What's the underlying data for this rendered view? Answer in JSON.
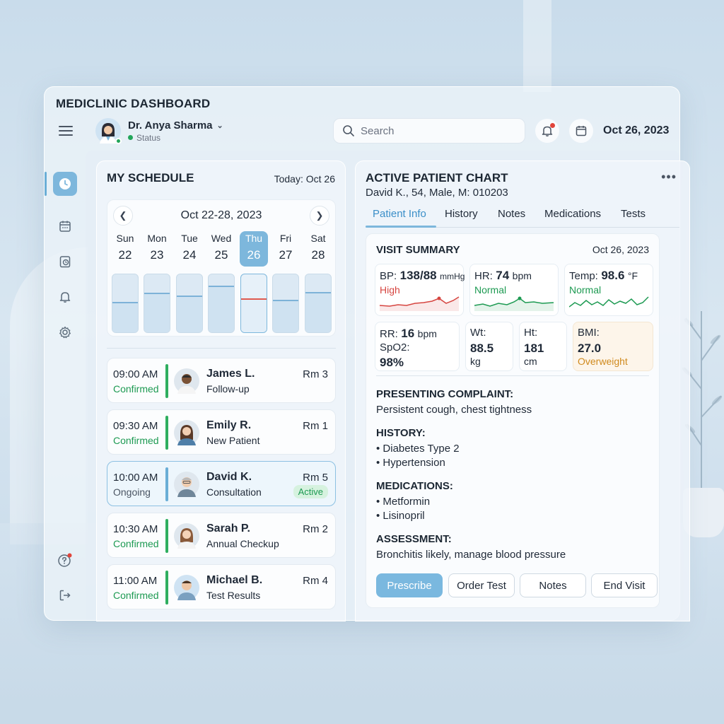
{
  "app": {
    "title": "MEDICLINIC DASHBOARD"
  },
  "header": {
    "doctor_name": "Dr. Anya Sharma",
    "doctor_status": "Status",
    "search_placeholder": "Search",
    "date": "Oct 26, 2023"
  },
  "sidebar": {
    "items": [
      {
        "icon": "clock-icon",
        "active": true
      },
      {
        "icon": "calendar-icon",
        "active": false
      },
      {
        "icon": "clipboard-clock-icon",
        "active": false
      },
      {
        "icon": "bell-icon",
        "active": false
      },
      {
        "icon": "gear-icon",
        "active": false
      },
      {
        "icon": "help-icon",
        "active": false
      },
      {
        "icon": "logout-icon",
        "active": false
      }
    ]
  },
  "schedule": {
    "title": "MY SCHEDULE",
    "today": "Today: Oct 26",
    "week_range": "Oct 22-28, 2023",
    "days": [
      {
        "name": "Sun",
        "date": "22",
        "load": 0.52
      },
      {
        "name": "Mon",
        "date": "23",
        "load": 0.68
      },
      {
        "name": "Tue",
        "date": "24",
        "load": 0.64
      },
      {
        "name": "Wed",
        "date": "25",
        "load": 0.8
      },
      {
        "name": "Thu",
        "date": "26",
        "load": 0.58,
        "active": true
      },
      {
        "name": "Fri",
        "date": "27",
        "load": 0.56
      },
      {
        "name": "Sat",
        "date": "28",
        "load": 0.7
      }
    ],
    "appointments": [
      {
        "time": "09:00 AM",
        "status": "Confirmed",
        "name": "James L.",
        "type": "Follow-up",
        "room": "Rm 3"
      },
      {
        "time": "09:30 AM",
        "status": "Confirmed",
        "name": "Emily R.",
        "type": "New Patient",
        "room": "Rm 1"
      },
      {
        "time": "10:00 AM",
        "status": "Ongoing",
        "name": "David K.",
        "type": "Consultation",
        "room": "Rm 5",
        "badge": "Active"
      },
      {
        "time": "10:30 AM",
        "status": "Confirmed",
        "name": "Sarah P.",
        "type": "Annual Checkup",
        "room": "Rm 2"
      },
      {
        "time": "11:00 AM",
        "status": "Confirmed",
        "name": "Michael B.",
        "type": "Test Results",
        "room": "Rm 4"
      }
    ]
  },
  "chart": {
    "title": "ACTIVE PATIENT CHART",
    "patient_line": "David K., 54,  Male,  M: 010203",
    "tabs": [
      "Patient Info",
      "History",
      "Notes",
      "Medications",
      "Tests"
    ],
    "summary_title": "VISIT SUMMARY",
    "summary_date": "Oct 26, 2023",
    "vitals": {
      "bp": {
        "label": "BP:",
        "value": "138/88",
        "unit": "mmHg",
        "status": "High"
      },
      "hr": {
        "label": "HR:",
        "value": "74",
        "unit": "bpm",
        "status": "Normal"
      },
      "temp": {
        "label": "Temp:",
        "value": "98.6",
        "unit": "°F",
        "status": "Normal"
      },
      "rr": {
        "label": "RR:",
        "value": "16",
        "unit": "bpm"
      },
      "spo2": {
        "label": "SpO2:",
        "value": "98%"
      },
      "wt": {
        "label": "Wt:",
        "value": "88.5",
        "unit": "kg"
      },
      "ht": {
        "label": "Ht:",
        "value": "181",
        "unit": "cm"
      },
      "bmi": {
        "label": "BMI:",
        "value": "27.0",
        "status": "Overweight"
      }
    },
    "complaint_h": "PRESENTING COMPLAINT:",
    "complaint": "Persistent cough, chest tightness",
    "history_h": "HISTORY:",
    "history": [
      "• Diabetes Type 2",
      "• Hypertension"
    ],
    "medications_h": "MEDICATIONS:",
    "medications": [
      "• Metformin",
      "• Lisinopril"
    ],
    "assessment_h": "ASSESSMENT:",
    "assessment": "Bronchitis likely, manage blood pressure",
    "actions": [
      "Prescribe",
      "Order Test",
      "Notes",
      "End Visit"
    ]
  },
  "colors": {
    "accent": "#7db7dc",
    "confirmed": "#1d9a52",
    "high": "#d64540",
    "overweight": "#d08a1e"
  }
}
